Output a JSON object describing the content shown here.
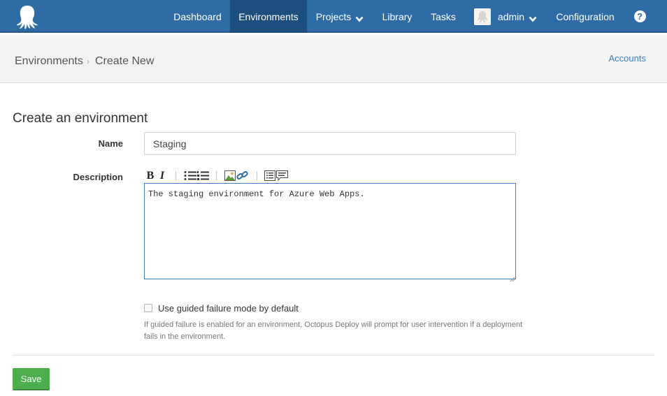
{
  "nav": {
    "logo_icon": "octopus-logo-icon",
    "items": [
      {
        "label": "Dashboard"
      },
      {
        "label": "Environments",
        "active": true
      },
      {
        "label": "Projects",
        "dropdown": true
      },
      {
        "label": "Library"
      },
      {
        "label": "Tasks"
      },
      {
        "label": "admin",
        "dropdown": true
      },
      {
        "label": "Configuration"
      }
    ],
    "help_symbol": "?"
  },
  "breadcrumb": {
    "items": [
      "Environments",
      "Create New"
    ],
    "separator": "›",
    "accounts_link": "Accounts"
  },
  "form": {
    "title": "Create an environment",
    "name_label": "Name",
    "name_value": "Staging",
    "description_label": "Description",
    "toolbar": [
      "bold-icon",
      "italic-icon",
      "bulleted-list-icon",
      "numbered-list-icon",
      "image-icon",
      "link-icon",
      "preview-icon",
      "comment-icon"
    ],
    "description_value": "The staging environment for Azure Web Apps.",
    "guided_failure_label": "Use guided failure mode by default",
    "guided_failure_checked": false,
    "guided_failure_help": "If guided failure is enabled for an environment, Octopus Deploy will prompt for user intervention if a deployment fails in the environment.",
    "save_label": "Save"
  },
  "colors": {
    "nav_bg": "#2f6ca6",
    "nav_active": "#1d4f7e",
    "link": "#3a7fbf",
    "save_bg": "#4cae4c"
  }
}
